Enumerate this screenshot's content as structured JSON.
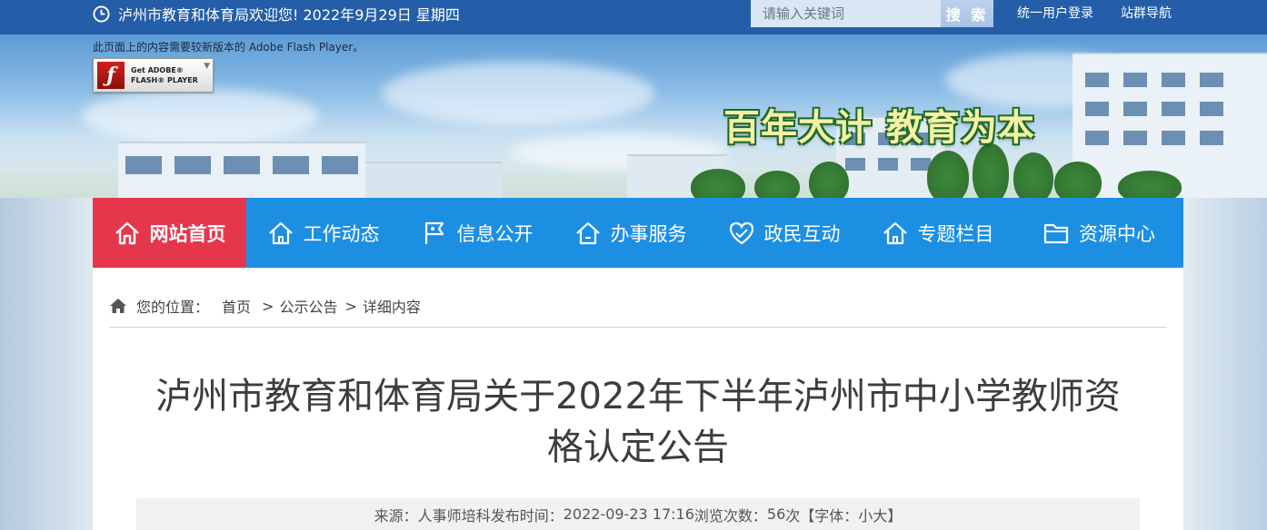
{
  "topbar": {
    "welcome": "泸州市教育和体育局欢迎您!  2022年9月29日 星期四",
    "search_placeholder": "请输入关键词",
    "search_button": "搜 索",
    "login_link": "统一用户登录",
    "sitemap_link": "站群导航",
    "background_color": "#245ea8"
  },
  "banner": {
    "flash_note": "此页面上的内容需要较新版本的 Adobe Flash Player。",
    "flash_badge_line1": "Get ADOBE®",
    "flash_badge_line2": "FLASH® PLAYER",
    "slogan": "百年大计   教育为本"
  },
  "nav": {
    "items": [
      {
        "label": "网站首页",
        "icon": "home-icon",
        "active": true
      },
      {
        "label": "工作动态",
        "icon": "house-icon",
        "active": false
      },
      {
        "label": "信息公开",
        "icon": "flag-icon",
        "active": false
      },
      {
        "label": "办事服务",
        "icon": "house-icon",
        "active": false
      },
      {
        "label": "政民互动",
        "icon": "heart-icon",
        "active": false
      },
      {
        "label": "专题栏目",
        "icon": "house-icon",
        "active": false
      },
      {
        "label": "资源中心",
        "icon": "folder-icon",
        "active": false
      }
    ],
    "background_color": "#1d8fe3",
    "active_color": "#e6364c"
  },
  "breadcrumb": {
    "prefix": "您的位置：",
    "home": "首页",
    "category": "公示公告",
    "current": "详细内容"
  },
  "article": {
    "title_line1": "泸州市教育和体育局关于2022年下半年泸州市中小学教师资",
    "title_line2": "格认定公告",
    "source_label": "来源：",
    "source": "人事师培科",
    "time_label": "发布时间：",
    "time": "2022-09-23 17:16",
    "views_label": "浏览次数：",
    "views": "56",
    "views_unit": "次",
    "font_label": "【字体：",
    "font_small": "小",
    "font_large": "大",
    "font_close": "】"
  }
}
